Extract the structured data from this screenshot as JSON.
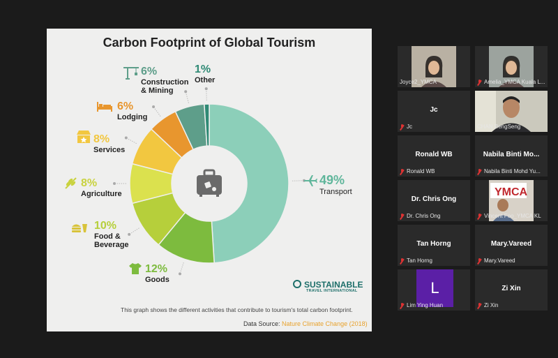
{
  "slide": {
    "title": "Carbon Footprint of Global Tourism",
    "caption": "This graph shows the different activities that contribute to tourism's total carbon footprint.",
    "source_prefix": "Data Source: ",
    "source_link": "Nature Climate Change (2018)",
    "logo_main": "SUSTAINABLE",
    "logo_sub": "TRAVEL INTERNATIONAL"
  },
  "chart_data": {
    "type": "pie",
    "categories": [
      "Transport",
      "Goods",
      "Food & Beverage",
      "Agriculture",
      "Services",
      "Lodging",
      "Construction & Mining",
      "Other"
    ],
    "values": [
      49,
      12,
      10,
      8,
      8,
      6,
      6,
      1
    ],
    "labels_pct": [
      "49%",
      "12%",
      "10%",
      "8%",
      "8%",
      "6%",
      "6%",
      "1%"
    ],
    "name_lines": [
      [
        "Transport"
      ],
      [
        "Goods"
      ],
      [
        "Food &",
        "Beverage"
      ],
      [
        "Agriculture"
      ],
      [
        "Services"
      ],
      [
        "Lodging"
      ],
      [
        "Construction",
        "& Mining"
      ],
      [
        "Other"
      ]
    ],
    "colors": [
      "#8ccfb9",
      "#7dbb3e",
      "#b6cf3b",
      "#dbe14e",
      "#f2c740",
      "#e8962e",
      "#5e9e8a",
      "#2f8a75"
    ]
  },
  "participants": [
    {
      "name": "Joyce2_YMCA",
      "title": "",
      "muted": false,
      "video": "woman"
    },
    {
      "name": "Amelia_YMCA Kuala L...",
      "title": "",
      "muted": true,
      "video": "woman2"
    },
    {
      "name": "Jc",
      "title": "Jc",
      "muted": true,
      "video": ""
    },
    {
      "name": "CHAN BengSeng",
      "title": "",
      "muted": false,
      "video": "man"
    },
    {
      "name": "Ronald WB",
      "title": "Ronald WB",
      "muted": true,
      "video": ""
    },
    {
      "name": "Nabila Binti Mohd Yu...",
      "title": "Nabila Binti Mo...",
      "muted": true,
      "video": ""
    },
    {
      "name": "Dr. Chris Ong",
      "title": "Dr. Chris Ong",
      "muted": true,
      "video": ""
    },
    {
      "name": "Vincent Foo_YMCA KL",
      "title": "",
      "muted": true,
      "video": "ymca"
    },
    {
      "name": "Tan Horng",
      "title": "Tan Horng",
      "muted": true,
      "video": ""
    },
    {
      "name": "Mary.Vareed",
      "title": "Mary.Vareed",
      "muted": true,
      "video": ""
    },
    {
      "name": "Lim Ying Huan",
      "title": "",
      "muted": true,
      "video": "L"
    },
    {
      "name": "Zi Xin",
      "title": "Zi Xin",
      "muted": true,
      "video": ""
    }
  ]
}
